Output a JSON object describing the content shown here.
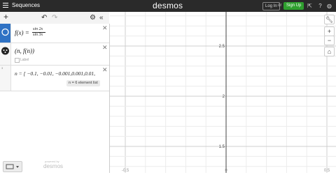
{
  "header": {
    "title": "Sequences",
    "brand": "desmos",
    "login_label": "Log In",
    "or_label": "or",
    "signup_label": "Sign Up",
    "colors": {
      "bar": "#2a2a2a",
      "signup": "#2e9f2e",
      "active": "#2f72c4"
    }
  },
  "toolbar": {
    "add_label": "+",
    "undo_icon": "undo-icon",
    "redo_icon": "redo-icon",
    "settings_icon": "gear-icon",
    "collapse_label": "«"
  },
  "expressions": [
    {
      "num": "1",
      "lhs": "f(x) =",
      "numer": "sin 2x",
      "denom": "sin 3x"
    },
    {
      "num": "",
      "text": "(n, f(n))",
      "label_text": "Label"
    },
    {
      "num": "3",
      "text": "n = [ −0.1, −0.01, −0.001,0.001,0.01,",
      "badge": "n = 6 element list"
    }
  ],
  "graph": {
    "y_ticks": [
      "2.5",
      "2",
      "1.5"
    ],
    "x_ticks": [
      "-0.5",
      "0",
      "0.5"
    ]
  },
  "footer": {
    "powered_by": "powered by",
    "brand": "desmos"
  }
}
